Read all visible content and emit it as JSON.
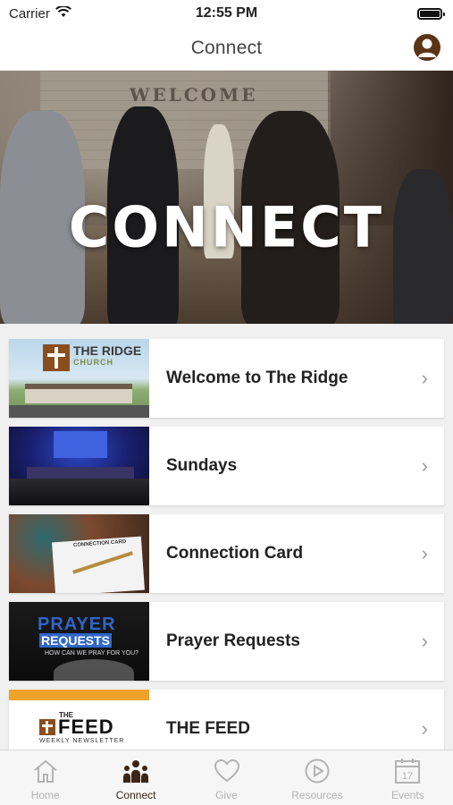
{
  "status_bar": {
    "carrier": "Carrier",
    "time": "12:55 PM"
  },
  "nav": {
    "title": "Connect",
    "profile_icon": "profile-icon"
  },
  "hero": {
    "title": "CONNECT",
    "sign_text": "WELCOME"
  },
  "menu": {
    "items": [
      {
        "label": "Welcome to The Ridge",
        "thumb": "ridge",
        "thumb_text": {
          "name": "THE RIDGE",
          "sub": "CHURCH"
        }
      },
      {
        "label": "Sundays",
        "thumb": "sundays"
      },
      {
        "label": "Connection Card",
        "thumb": "card",
        "thumb_text": {
          "title": "CONNECTION CARD"
        }
      },
      {
        "label": "Prayer Requests",
        "thumb": "prayer",
        "thumb_text": {
          "line1": "PRAYER",
          "line2": "REQUESTS",
          "line3": "HOW CAN WE PRAY FOR YOU?"
        }
      },
      {
        "label": "THE FEED",
        "thumb": "feed",
        "thumb_text": {
          "the": "THE",
          "feed": "FEED",
          "sub": "WEEKLY NEWSLETTER"
        }
      }
    ]
  },
  "tabs": [
    {
      "label": "Home",
      "icon": "home-icon",
      "active": false
    },
    {
      "label": "Connect",
      "icon": "people-icon",
      "active": true
    },
    {
      "label": "Give",
      "icon": "heart-icon",
      "active": false
    },
    {
      "label": "Resources",
      "icon": "play-icon",
      "active": false
    },
    {
      "label": "Events",
      "icon": "calendar-icon",
      "active": false,
      "calendar_day": "17"
    }
  ],
  "colors": {
    "brand_brown": "#3b2515",
    "tab_inactive": "#b3b3b3",
    "accent_orange": "#f0a22b",
    "prayer_blue": "#2f66c8"
  }
}
